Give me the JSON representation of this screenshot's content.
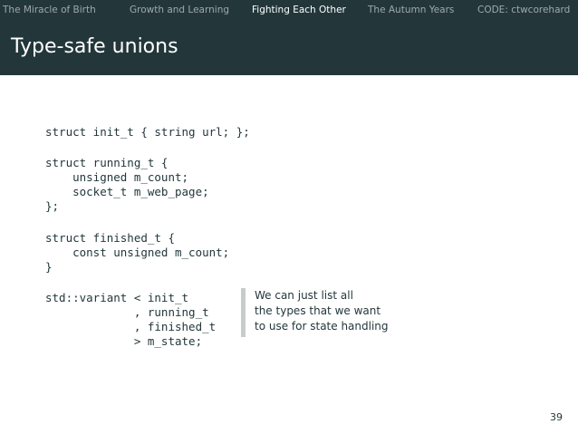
{
  "nav": {
    "items": [
      "The Miracle of Birth",
      "Growth and Learning",
      "Fighting Each Other",
      "The Autumn Years",
      "CODE: ctwcorehard"
    ],
    "active_index": 2
  },
  "slide": {
    "title": "Type-safe unions",
    "code_block_1": "struct init_t { string url; };",
    "code_block_2": "struct running_t {\n    unsigned m_count;\n    socket_t m_web_page;\n};",
    "code_block_3": "struct finished_t {\n    const unsigned m_count;\n}",
    "code_block_4": "std::variant < init_t\n             , running_t\n             , finished_t\n             > m_state;",
    "callout_lines": [
      "We can just list all",
      "the types that we want",
      "to use for state handling"
    ],
    "page_number": "39"
  },
  "colors": {
    "header_bg": "#23373b",
    "active_nav": "#ffffff",
    "inactive_nav": "#9fa8aa",
    "text": "#23373b",
    "callout_bar": "#c7cbcc"
  }
}
